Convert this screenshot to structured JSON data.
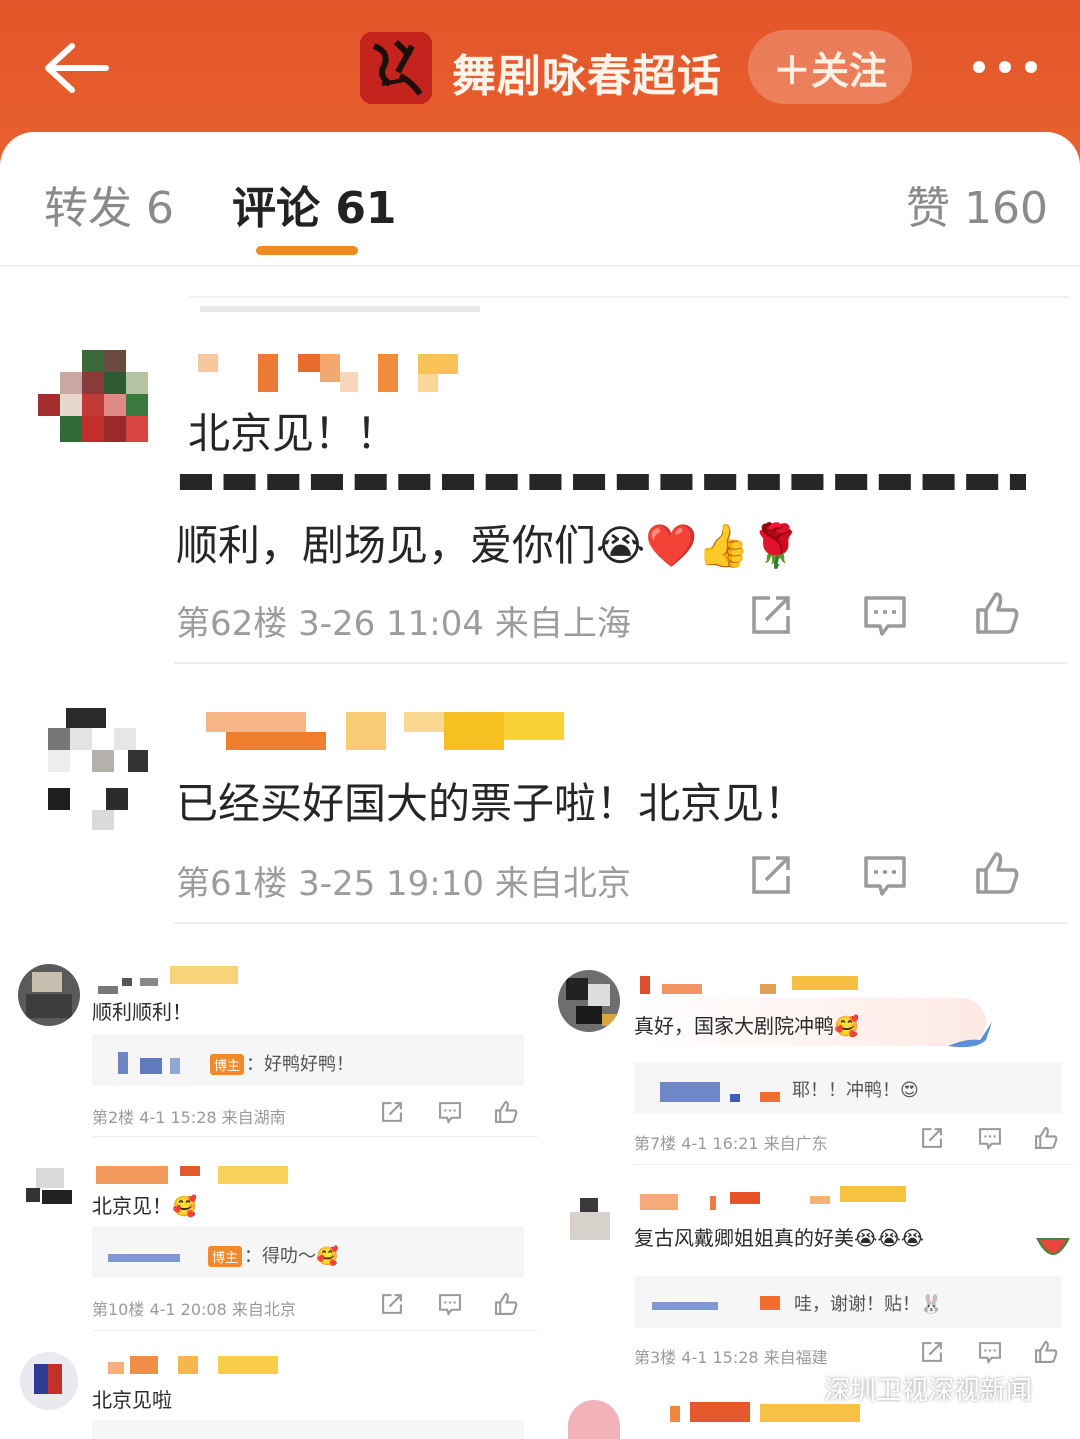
{
  "header": {
    "title": "舞剧咏春超话",
    "follow_label": "＋关注",
    "logo_text": "咏春"
  },
  "tabs": {
    "forward": "转发 6",
    "comments": "评论 61",
    "likes": "赞 160"
  },
  "comments": [
    {
      "text": "北京见！！",
      "partial_line": "顺利，剧场见，爱你们😭❤️👍🌹",
      "meta": "第62楼 3-26 11:04  来自上海"
    },
    {
      "text": "已经买好国大的票子啦！北京见！",
      "meta": "第61楼 3-25 19:10  来自北京"
    }
  ],
  "collage_left": [
    {
      "text": "顺利顺利！",
      "reply_badge": "博主",
      "reply": "：好鸭好鸭！",
      "meta": "第2楼  4-1 15:28  来自湖南"
    },
    {
      "text": "北京见！🥰",
      "reply_badge": "博主",
      "reply": "：得叻～🥰",
      "meta": "第10楼  4-1 20:08  来自北京"
    },
    {
      "text": "北京见啦"
    }
  ],
  "collage_right": [
    {
      "text": "真好，国家大剧院冲鸭🥰",
      "reply": "耶！！冲鸭！😍",
      "meta": "第7楼  4-1 16:21  来自广东"
    },
    {
      "text": "复古风戴卿姐姐真的好美😭😭😭",
      "reply": "哇，谢谢！贴！🐰",
      "meta": "第3楼  4-1 15:28  来自福建"
    }
  ],
  "watermark": "深圳卫视深视新闻",
  "colors": {
    "header": "#e2552a",
    "accent": "#f18a1e",
    "meta_gray": "#9c9c9c"
  }
}
